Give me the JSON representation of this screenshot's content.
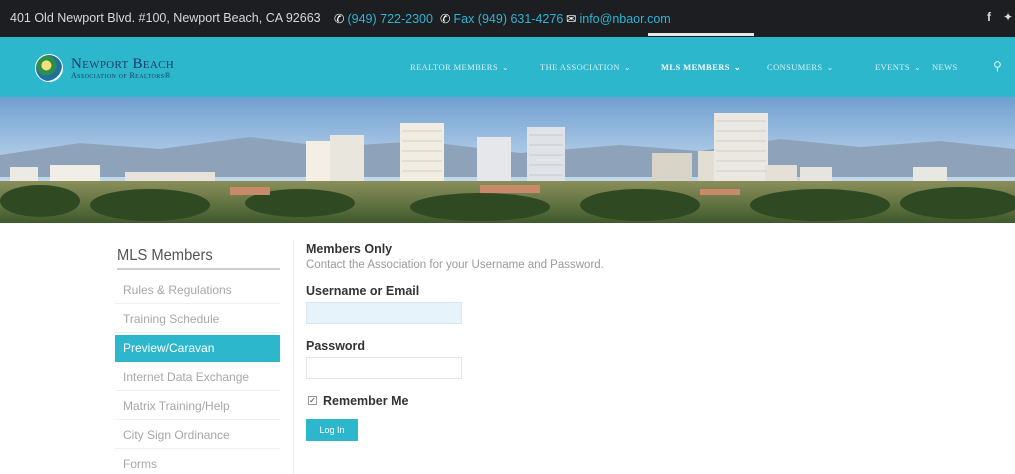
{
  "topbar": {
    "address": "401 Old Newport Blvd. #100, Newport Beach, CA 92663",
    "phone": "(949) 722-2300",
    "fax": "Fax (949) 631-4276",
    "email": "info@nbaor.com",
    "phone_icon": "phone-icon",
    "email_icon": "envelope-icon"
  },
  "logo": {
    "title": "Newport Beach",
    "subtitle": "Association of Realtors®"
  },
  "nav": {
    "items": [
      {
        "label": "REALTOR MEMBERS",
        "chevron": "⌄"
      },
      {
        "label": "THE ASSOCIATION",
        "chevron": "⌄"
      },
      {
        "label": "MLS MEMBERS",
        "chevron": "⌄"
      },
      {
        "label": "CONSUMERS",
        "chevron": "⌄"
      },
      {
        "label": "EVENTS",
        "chevron": "⌄"
      },
      {
        "label": "NEWS",
        "chevron": ""
      }
    ],
    "active_index": 2
  },
  "sidebar": {
    "title": "MLS Members",
    "items": [
      {
        "label": "Rules & Regulations"
      },
      {
        "label": "Training Schedule"
      },
      {
        "label": "Preview/Caravan"
      },
      {
        "label": "Internet Data Exchange"
      },
      {
        "label": "Matrix Training/Help"
      },
      {
        "label": "City Sign Ordinance"
      },
      {
        "label": "Forms"
      }
    ],
    "active_index": 2
  },
  "login": {
    "heading": "Members Only",
    "description": "Contact the Association for your Username and Password.",
    "username_label": "Username or Email",
    "username_value": "",
    "password_label": "Password",
    "password_value": "",
    "remember_label": "Remember Me",
    "remember_checked": true,
    "submit_label": "Log In"
  },
  "colors": {
    "accent": "#2cb7cc",
    "topbar": "#1d1e22",
    "link": "#2bb5d3"
  }
}
